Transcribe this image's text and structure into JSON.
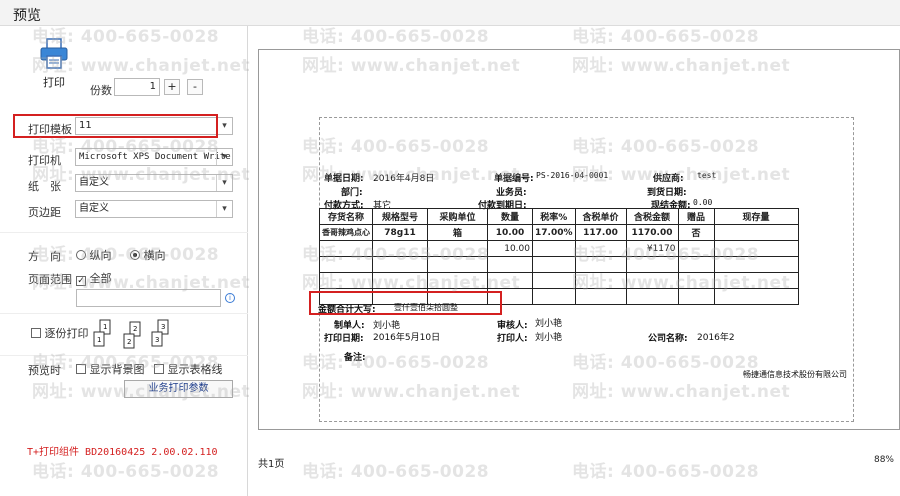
{
  "window": {
    "title": "预览"
  },
  "left": {
    "print_label": "打印",
    "copies_label": "份数",
    "copies_value": "1",
    "plus": "+",
    "minus": "-",
    "template_label": "打印模板",
    "template_value": "11",
    "printer_label": "打印机",
    "printer_value": "Microsoft XPS Document Writer",
    "paper_label": "纸　张",
    "paper_value": "自定义",
    "margin_label": "页边距",
    "margin_value": "自定义",
    "orientation_label": "方　向",
    "orientation_portrait": "纵向",
    "orientation_landscape": "横向",
    "orientation_selected": "landscape",
    "range_label": "页面范围",
    "range_all": "全部",
    "range_all_checked": true,
    "range_input": "",
    "collate_label": "逐份打印",
    "collate_checked": false,
    "preview_label": "预览时",
    "show_bg_label": "显示背景图",
    "show_grid_label": "显示表格线",
    "biz_params_label": "业务打印参数",
    "version": "T+打印组件 BD20160425 2.00.02.110"
  },
  "doc": {
    "date_label": "单据日期:",
    "date_value": "2016年4月8日",
    "code_label": "单据编号:",
    "code_value": "PS-2016-04-0001",
    "vendor_label": "供应商:",
    "vendor_value": "test",
    "dept_label": "部门:",
    "salesman_label": "业务员:",
    "arrival_label": "到货日期:",
    "pay_method_label": "付款方式:",
    "pay_method_value": "其它",
    "pay_due_label": "付款到期日:",
    "cash_label": "现结金额:",
    "cash_value": "0.00",
    "table_headers": [
      "存货名称",
      "规格型号",
      "采购单位",
      "数量",
      "税率%",
      "含税单价",
      "含税金额",
      "赠品",
      "现存量"
    ],
    "table_rows": [
      [
        "香哥辣鸡点心",
        "78g11",
        "箱",
        "10.00",
        "17.00%",
        "117.00",
        "1170.00",
        "否",
        ""
      ],
      [
        "",
        "",
        "",
        "10.00",
        "",
        "",
        "¥1170",
        "",
        ""
      ],
      [
        "",
        "",
        "",
        "",
        "",
        "",
        "",
        "",
        ""
      ],
      [
        "",
        "",
        "",
        "",
        "",
        "",
        "",
        "",
        ""
      ],
      [
        "",
        "",
        "",
        "",
        "",
        "",
        "",
        "",
        ""
      ]
    ],
    "total_label": "金额合计大写:",
    "total_value": "壹仟壹佰柒拾圆整",
    "maker_label": "制单人:",
    "maker_value": "刘小艳",
    "auditor_label": "审核人:",
    "auditor_value": "刘小艳",
    "print_date_label": "打印日期:",
    "print_date_value": "2016年5月10日",
    "printer_person_label": "打印人:",
    "printer_person_value": "刘小艳",
    "company_label": "公司名称:",
    "company_value": "2016年2",
    "remark_label": "备注:",
    "footer_company": "畅捷通信息技术股份有限公司"
  },
  "status": {
    "pages": "共1页",
    "zoom": "88%"
  },
  "watermark": {
    "phone": "电话: 400-665-0028",
    "site": "网址: www.chanjet.net"
  },
  "colors": {
    "highlight": "#d42020",
    "version_text": "#d42020"
  }
}
